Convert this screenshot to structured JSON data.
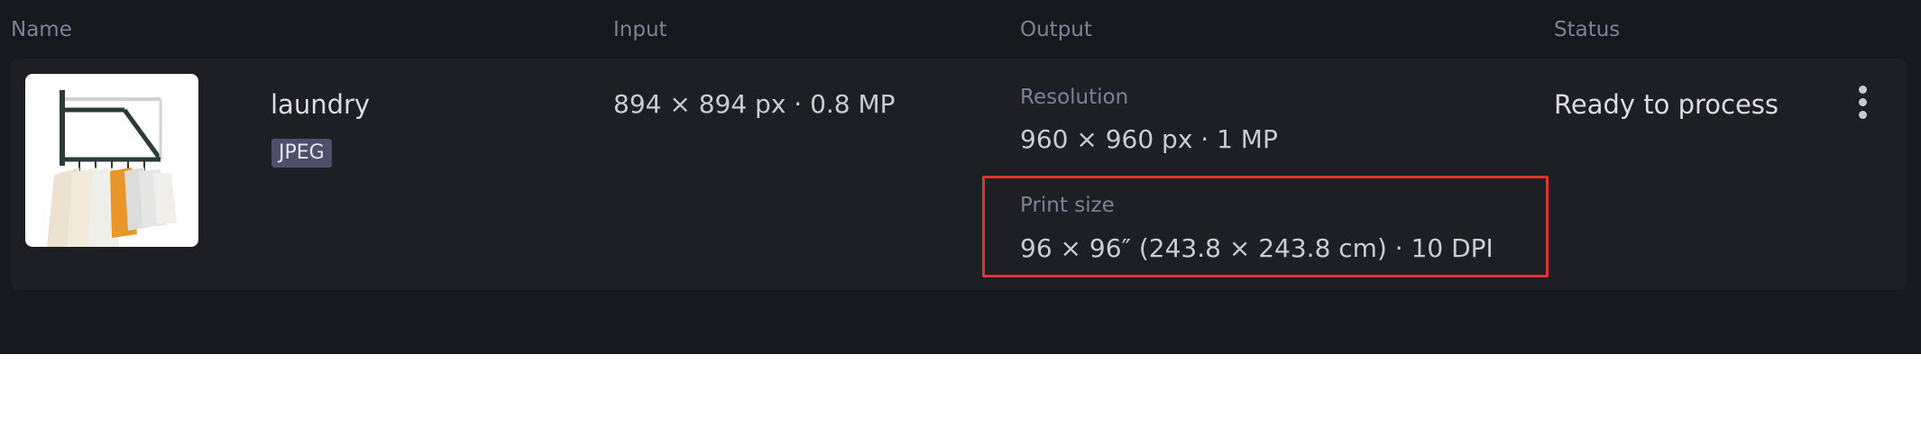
{
  "header": {
    "name": "Name",
    "input": "Input",
    "output": "Output",
    "status": "Status"
  },
  "file": {
    "name": "laundry",
    "format": "JPEG",
    "thumbnail_icon": "clothes-rack-thumbnail",
    "input": "894 × 894 px · 0.8 MP",
    "output": {
      "resolution_label": "Resolution",
      "resolution_value": "960 × 960 px · 1 MP",
      "print_size_label": "Print size",
      "print_size_value": "96 × 96″ (243.8 × 243.8 cm) · 10 DPI"
    },
    "status": "Ready to process"
  },
  "icons": {
    "more": "more-vertical-icon"
  },
  "colors": {
    "background": "#17181d",
    "row_background": "#1e1f25",
    "highlight": "#e03333",
    "badge": "#4d5068"
  }
}
